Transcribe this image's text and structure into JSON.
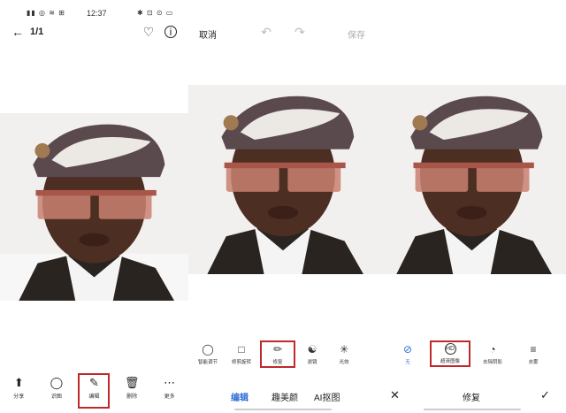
{
  "status": {
    "left_icons": "▮▮ ◎ ≋ ⊞",
    "time": "12:37",
    "right_icons": "✱ ⊡ ⊙ ▭"
  },
  "viewer": {
    "page_counter": "1/1",
    "nav": [
      {
        "label": "分享",
        "icon": "share-icon"
      },
      {
        "label": "识图",
        "icon": "recognize-icon"
      },
      {
        "label": "编辑",
        "icon": "edit-icon",
        "highlighted": true
      },
      {
        "label": "删除",
        "icon": "trash-icon"
      },
      {
        "label": "更多",
        "icon": "more-icon"
      }
    ]
  },
  "editor": {
    "cancel": "取消",
    "save": "保存",
    "tools": [
      {
        "label": "智能调节",
        "icon": "bulb-icon"
      },
      {
        "label": "修剪旋转",
        "icon": "crop-icon"
      },
      {
        "label": "修复",
        "icon": "bandage-icon",
        "highlighted": true
      },
      {
        "label": "滤镜",
        "icon": "filter-icon"
      },
      {
        "label": "光效",
        "icon": "light-icon"
      }
    ],
    "tabs": [
      {
        "label": "编辑",
        "active": true
      },
      {
        "label": "趣美颜",
        "active": false
      },
      {
        "label": "AI抠图",
        "active": false
      }
    ]
  },
  "repair": {
    "title": "修复",
    "options": [
      {
        "label": "无",
        "icon": "none-icon",
        "active": true
      },
      {
        "label": "超清图像",
        "icon": "hd-icon",
        "highlighted": true
      },
      {
        "label": "去除阴影",
        "icon": "shadow-icon"
      },
      {
        "label": "去雾",
        "icon": "dehaze-icon"
      }
    ]
  },
  "colors": {
    "accent_blue": "#2f6fd6",
    "highlight_red": "#c0282c"
  }
}
